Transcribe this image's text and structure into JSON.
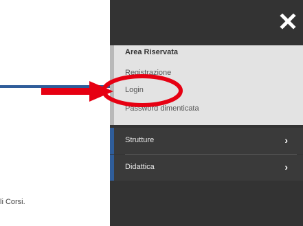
{
  "background": {
    "partial_text": "li Corsi."
  },
  "panel": {
    "close_icon": "close-icon",
    "area_title": "Area Riservata",
    "links": [
      "Registrazione",
      "Login",
      "Password dimenticata"
    ],
    "nav": [
      {
        "label": "Strutture",
        "icon": "chevron-right-icon"
      },
      {
        "label": "Didattica",
        "icon": "chevron-right-icon"
      }
    ]
  },
  "annotation": {
    "arrow_color": "#e60012",
    "circle_color": "#e60012"
  },
  "colors": {
    "panel_dark": "#333333",
    "area_bg": "#e3e3e3",
    "accent_blue": "#2f5d9a"
  }
}
